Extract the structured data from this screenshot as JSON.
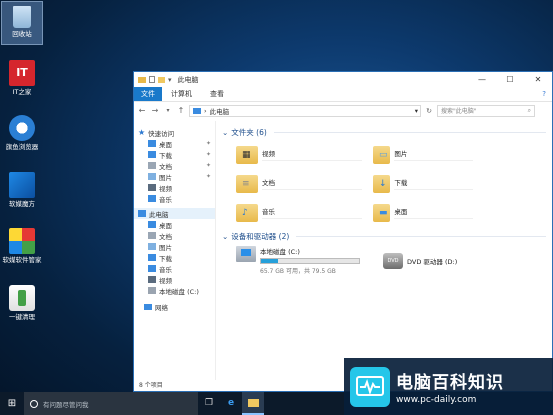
{
  "desktop": {
    "icons": [
      {
        "label": "回收站",
        "icon": "recycle-bin-icon"
      },
      {
        "label": "IT之家",
        "icon": "ithome-icon"
      },
      {
        "label": "旗鱼浏览器",
        "icon": "browser-icon"
      },
      {
        "label": "软媒魔方",
        "icon": "cube-icon"
      },
      {
        "label": "软媒软件管家",
        "icon": "software-manager-icon"
      },
      {
        "label": "一键清理",
        "icon": "cleanup-icon"
      }
    ],
    "it_logo_text": "IT"
  },
  "window": {
    "title": "此电脑",
    "controls": {
      "minimize": "—",
      "maximize": "☐",
      "close": "✕"
    },
    "ribbon": {
      "file": "文件",
      "tabs": [
        "计算机",
        "查看"
      ]
    },
    "address": {
      "path": "此电脑",
      "search_placeholder": "搜索\"此电脑\""
    },
    "nav": {
      "quick_access": "快速访问",
      "quick_items": [
        {
          "label": "桌面",
          "pinned": true
        },
        {
          "label": "下载",
          "pinned": true
        },
        {
          "label": "文档",
          "pinned": true
        },
        {
          "label": "图片",
          "pinned": true
        },
        {
          "label": "视频",
          "pinned": false
        },
        {
          "label": "音乐",
          "pinned": false
        }
      ],
      "this_pc": "此电脑",
      "pc_items": [
        "桌面",
        "文档",
        "图片",
        "下载",
        "音乐",
        "视频",
        "本地磁盘 (C:)"
      ],
      "network": "网络"
    },
    "folders_header": "文件夹 (6)",
    "folders": [
      "视频",
      "图片",
      "文档",
      "下载",
      "音乐",
      "桌面"
    ],
    "drives_header": "设备和驱动器 (2)",
    "drives": {
      "c_name": "本地磁盘 (C:)",
      "c_free": "65.7 GB 可用，共 79.5 GB",
      "c_used_fraction": 0.174,
      "dvd_name": "DVD 驱动器 (D:)",
      "dvd_label": "DVD"
    },
    "status": "8 个项目"
  },
  "taskbar": {
    "search_placeholder": "有问题尽管问我"
  },
  "watermark": {
    "title": "电脑百科知识",
    "url": "www.pc-daily.com"
  }
}
